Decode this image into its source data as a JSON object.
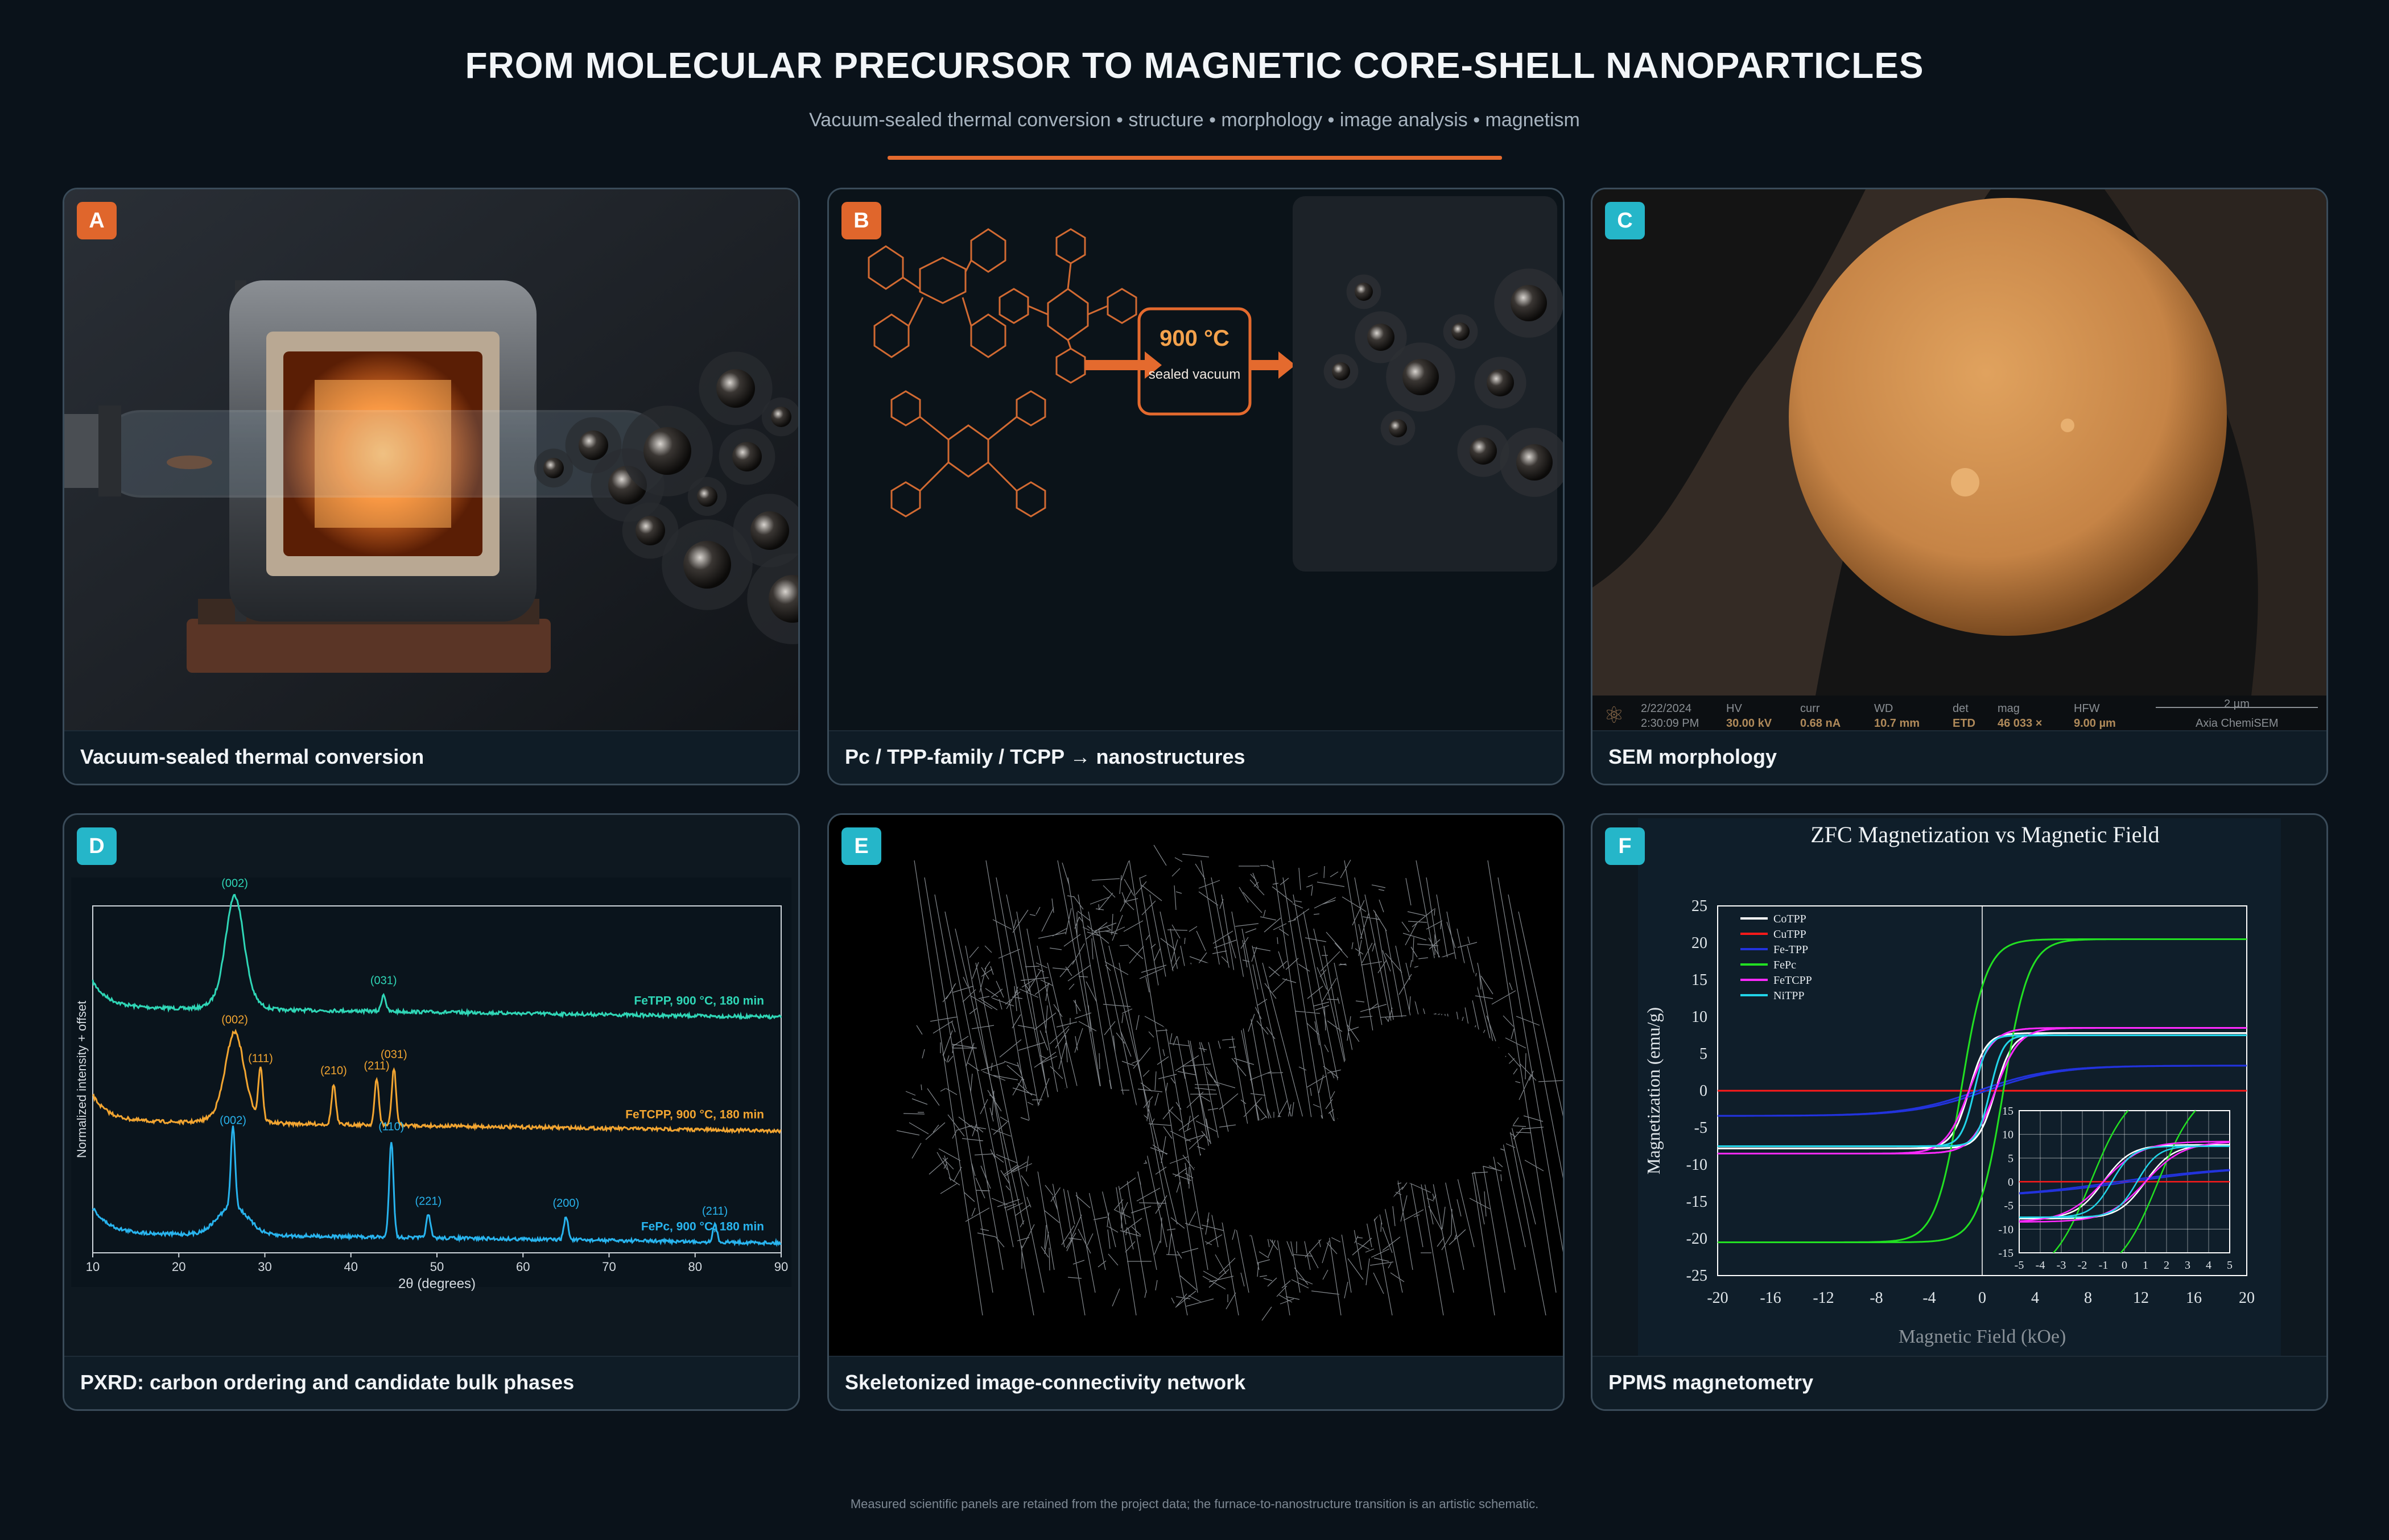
{
  "header": {
    "title": "FROM MOLECULAR PRECURSOR TO MAGNETIC CORE-SHELL NANOPARTICLES",
    "subtitle": "Vacuum-sealed thermal conversion  •  structure  •  morphology  •  image analysis  •  magnetism"
  },
  "panels": {
    "a": {
      "badge": "A",
      "caption": "Vacuum-sealed thermal conversion"
    },
    "b": {
      "badge": "B",
      "caption": "Pc / TPP-family / TCPP → nanostructures",
      "temp": "900 °C",
      "cond": "sealed vacuum"
    },
    "c": {
      "badge": "C",
      "caption": "SEM morphology",
      "sem": {
        "date": "2/22/2024",
        "time": "2:30:09 PM",
        "hv_l": "HV",
        "hv": "30.00 kV",
        "curr_l": "curr",
        "curr": "0.68 nA",
        "wd_l": "WD",
        "wd": "10.7 mm",
        "det_l": "det",
        "det": "ETD",
        "mag_l": "mag",
        "mag": "46 033 ×",
        "hfw_l": "HFW",
        "hfw": "9.00 µm",
        "scale": "2 µm",
        "brand": "Axia ChemiSEM"
      }
    },
    "d": {
      "badge": "D",
      "caption": "PXRD: carbon ordering and candidate bulk phases"
    },
    "e": {
      "badge": "E",
      "caption": "Skeletonized image-connectivity network"
    },
    "f": {
      "badge": "F",
      "caption": "PPMS magnetometry"
    }
  },
  "footer": {
    "note": "Measured scientific panels are retained from the project data; the furnace-to-nanostructure transition is an artistic schematic."
  },
  "chart_data": [
    {
      "type": "line",
      "xlabel": "2θ (degrees)",
      "ylabel": "Normalized intensity + offset",
      "xlim": [
        10,
        90
      ],
      "xticks": [
        10,
        20,
        30,
        40,
        50,
        60,
        70,
        80,
        90
      ],
      "series": [
        {
          "name": "FeTPP, 900 °C, 180 min",
          "color": "#2fd6b6",
          "peaks": [
            {
              "x": 26.5,
              "label": "(002)"
            },
            {
              "x": 43.8,
              "label": "(031)"
            }
          ]
        },
        {
          "name": "FeTCPP, 900 °C, 180 min",
          "color": "#f2a531",
          "peaks": [
            {
              "x": 26.5,
              "label": "(002)"
            },
            {
              "x": 29.5,
              "label": "(111)"
            },
            {
              "x": 38,
              "label": "(210)"
            },
            {
              "x": 43.0,
              "label": "(211)"
            },
            {
              "x": 45.0,
              "label": "(031)"
            }
          ]
        },
        {
          "name": "FePc, 900 °C, 180 min",
          "color": "#28b4ee",
          "peaks": [
            {
              "x": 26.3,
              "label": "(002)"
            },
            {
              "x": 44.7,
              "label": "(110)"
            },
            {
              "x": 49.0,
              "label": "(221)"
            },
            {
              "x": 65.0,
              "label": "(200)"
            },
            {
              "x": 82.3,
              "label": "(211)"
            }
          ]
        }
      ]
    },
    {
      "type": "line",
      "title": "ZFC Magnetization vs Magnetic Field",
      "xlabel": "Magnetic Field (kOe)",
      "ylabel": "Magnetization (emu/g)",
      "xlim": [
        -20,
        20
      ],
      "ylim": [
        -25,
        25
      ],
      "xticks": [
        -20,
        -16,
        -12,
        -8,
        -4,
        0,
        4,
        8,
        12,
        16,
        20
      ],
      "yticks": [
        -25,
        -20,
        -15,
        -10,
        -5,
        0,
        5,
        10,
        15,
        20,
        25
      ],
      "series": [
        {
          "name": "CoTPP",
          "color": "#ffffff",
          "ms": 7.8,
          "hc": 1.0,
          "k": 1.3
        },
        {
          "name": "CuTPP",
          "color": "#ff1a1a",
          "ms": 0.0,
          "hc": 0,
          "k": 1
        },
        {
          "name": "Fe-TPP",
          "color": "#2233dd",
          "ms": 3.4,
          "hc": 0.3,
          "k": 5.5
        },
        {
          "name": "FePc",
          "color": "#22e022",
          "ms": 20.5,
          "hc": 1.6,
          "k": 1.9
        },
        {
          "name": "FeTCPP",
          "color": "#ff2aff",
          "ms": 8.5,
          "hc": 1.0,
          "k": 1.8
        },
        {
          "name": "NiTPP",
          "color": "#22d4e8",
          "ms": 7.5,
          "hc": 0.6,
          "k": 1.0
        }
      ],
      "inset": {
        "xlim": [
          -5,
          5
        ],
        "ylim": [
          -15,
          15
        ],
        "xticks": [
          -5,
          -4,
          -3,
          -2,
          -1,
          0,
          1,
          2,
          3,
          4,
          5
        ],
        "yticks": [
          -15,
          -10,
          -5,
          0,
          5,
          10,
          15
        ]
      }
    }
  ]
}
